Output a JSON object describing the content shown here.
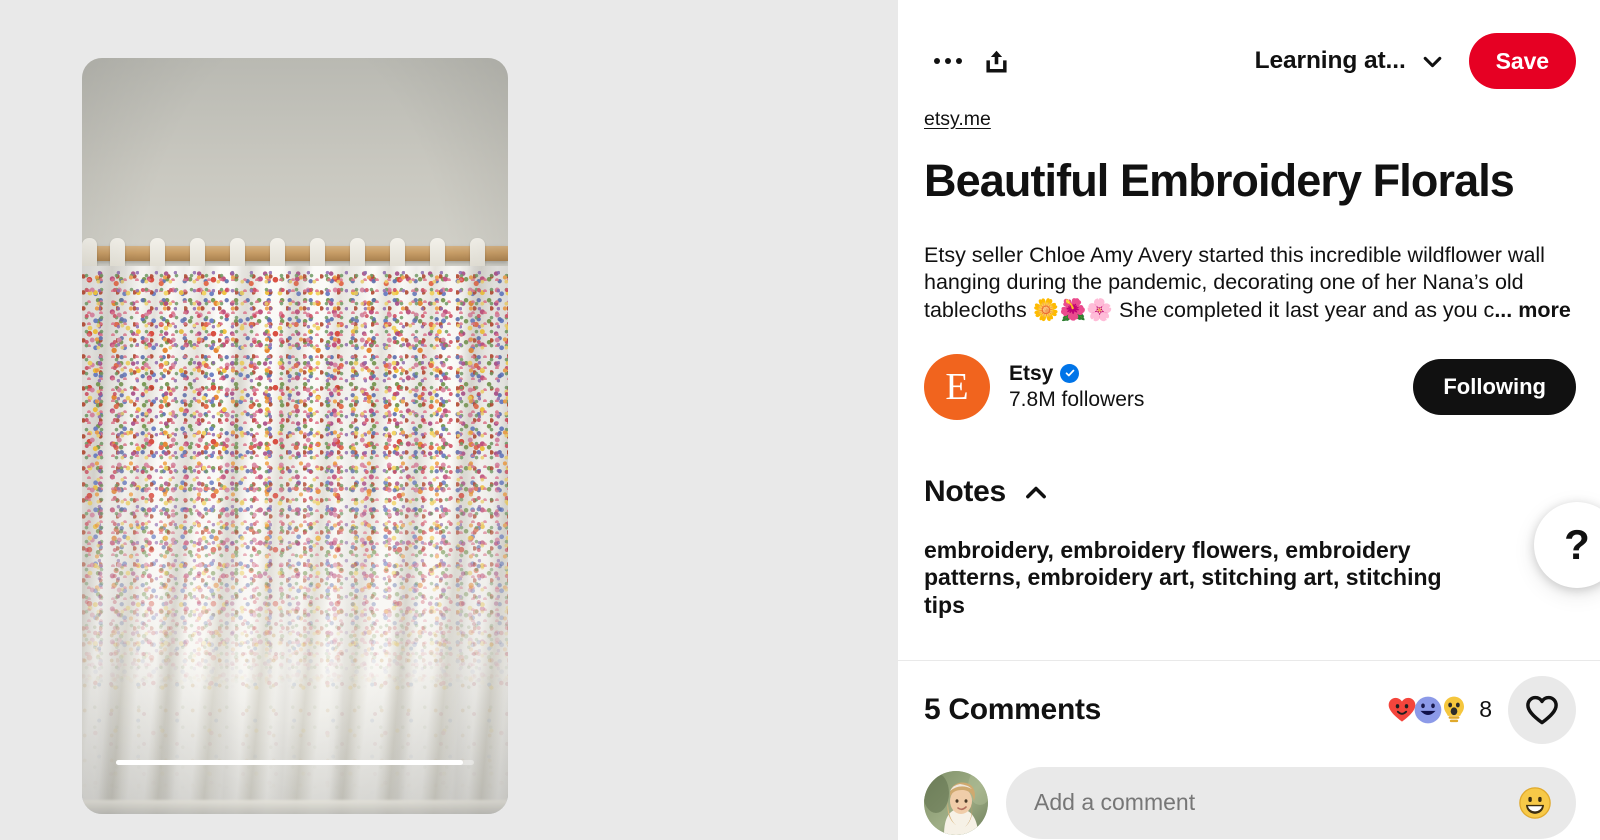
{
  "media": {
    "alt": "Embroidered wildflower wall hanging on a wooden rod",
    "progress_percent": 97
  },
  "toolbar": {
    "more_options_label": "More options",
    "share_label": "Share",
    "board_name": "Learning at...",
    "save_label": "Save"
  },
  "pin": {
    "source_domain": "etsy.me",
    "title": "Beautiful Embroidery Florals",
    "description": "Etsy seller Chloe Amy Avery started this incredible wildflower wall hanging during the pandemic, decorating one of her Nana’s old tablecloths 🌼🌺🌸 She completed it last year and as you c",
    "more_label": "... more"
  },
  "creator": {
    "avatar_letter": "E",
    "avatar_color": "#f1641e",
    "name": "Etsy",
    "verified": true,
    "followers": "7.8M followers",
    "follow_button_label": "Following"
  },
  "notes": {
    "title": "Notes",
    "collapse_icon": "chevron-up-icon",
    "text": "embroidery, embroidery flowers, embroidery patterns, embroidery art, stitching art, stitching tips"
  },
  "help": {
    "label": "?"
  },
  "comments": {
    "count_label": "5 Comments",
    "reactions": [
      {
        "name": "heart-face-emoji",
        "color": "#f43f3f"
      },
      {
        "name": "smiley-face-emoji",
        "color": "#8c9ae8"
      },
      {
        "name": "lightbulb-emoji",
        "color": "#f5c63d"
      }
    ],
    "reaction_total": "8",
    "like_icon": "heart-outline-icon"
  },
  "composer": {
    "placeholder": "Add a comment",
    "value": "",
    "emoji_icon": "grinning-face-icon"
  },
  "colors": {
    "brand_red": "#e60023",
    "panel_bg": "#e9e9e9",
    "text": "#111111",
    "verified_blue": "#0074e8"
  }
}
